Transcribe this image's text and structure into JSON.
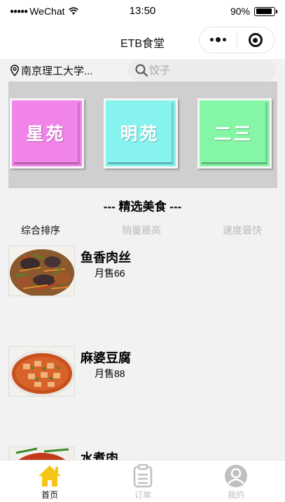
{
  "status_bar": {
    "signal": "●●●●●",
    "carrier": "WeChat",
    "time": "13:50",
    "battery": "90%",
    "battery_level": 0.9
  },
  "nav": {
    "title": "ETB食堂"
  },
  "location": {
    "text": "南京理工大学..."
  },
  "search": {
    "placeholder": "饺子"
  },
  "canteens": [
    {
      "name": "星苑",
      "color": "#f184e8"
    },
    {
      "name": "明苑",
      "color": "#86f3ef"
    },
    {
      "name": "二三",
      "color": "#84f6a6"
    }
  ],
  "section": {
    "title": "--- 精选美食 ---"
  },
  "sort_tabs": [
    {
      "label": "综合排序",
      "active": true
    },
    {
      "label": "销量最高",
      "active": false
    },
    {
      "label": "速度最快",
      "active": false
    }
  ],
  "foods": [
    {
      "name": "鱼香肉丝",
      "sales": "月售66"
    },
    {
      "name": "麻婆豆腐",
      "sales": "月售88"
    },
    {
      "name": "水煮肉",
      "sales": ""
    }
  ],
  "tab_bar": [
    {
      "label": "首页",
      "icon": "home-icon",
      "active": true
    },
    {
      "label": "订单",
      "icon": "order-icon",
      "active": false
    },
    {
      "label": "我的",
      "icon": "profile-icon",
      "active": false
    }
  ],
  "colors": {
    "accent": "#f5c518",
    "banner_bg": "#cfcfcf",
    "inactive": "#bfbfbf"
  }
}
